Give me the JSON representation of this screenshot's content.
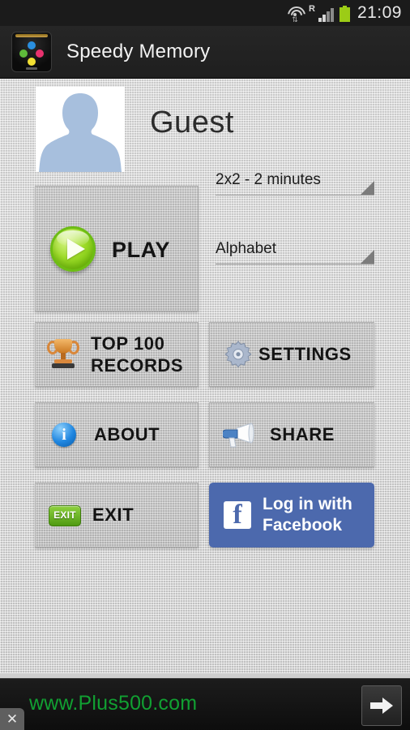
{
  "statusbar": {
    "clock": "21:09",
    "icons": [
      "wifi-icon",
      "roaming-indicator",
      "signal-icon",
      "battery-icon"
    ],
    "roaming_label": "R"
  },
  "actionbar": {
    "app_icon": "speedy-memory-app-icon",
    "title": "Speedy Memory"
  },
  "profile": {
    "avatar_icon": "default-avatar-icon",
    "username": "Guest"
  },
  "play": {
    "label": "PLAY",
    "icon": "play-circle-icon"
  },
  "spinners": [
    {
      "name": "game-mode",
      "value": "2x2 - 2 minutes",
      "arrow_icon": "spinner-triangle-icon"
    },
    {
      "name": "card-deck",
      "value": "Alphabet",
      "arrow_icon": "spinner-triangle-icon"
    }
  ],
  "buttons": [
    {
      "name": "top-100-records",
      "label": "TOP 100\nRECORDS",
      "line1": "TOP 100",
      "line2": "RECORDS",
      "icon": "trophy-icon"
    },
    {
      "name": "settings",
      "label": "SETTINGS",
      "icon": "gear-icon"
    },
    {
      "name": "about",
      "label": "ABOUT",
      "icon": "info-icon"
    },
    {
      "name": "share",
      "label": "SHARE",
      "icon": "megaphone-icon"
    },
    {
      "name": "exit",
      "label": "EXIT",
      "icon": "exit-badge-icon",
      "icon_text": "EXIT"
    }
  ],
  "facebook": {
    "label": "Log in with Facebook",
    "line1": "Log in with",
    "line2": "Facebook",
    "icon": "facebook-f-icon",
    "icon_glyph": "f",
    "color": "#4c69ad"
  },
  "ad": {
    "text": "www.Plus500.com",
    "text_color": "#11a032",
    "arrow_icon": "arrow-right-icon",
    "close_icon": "close-icon",
    "close_glyph": "✕"
  }
}
